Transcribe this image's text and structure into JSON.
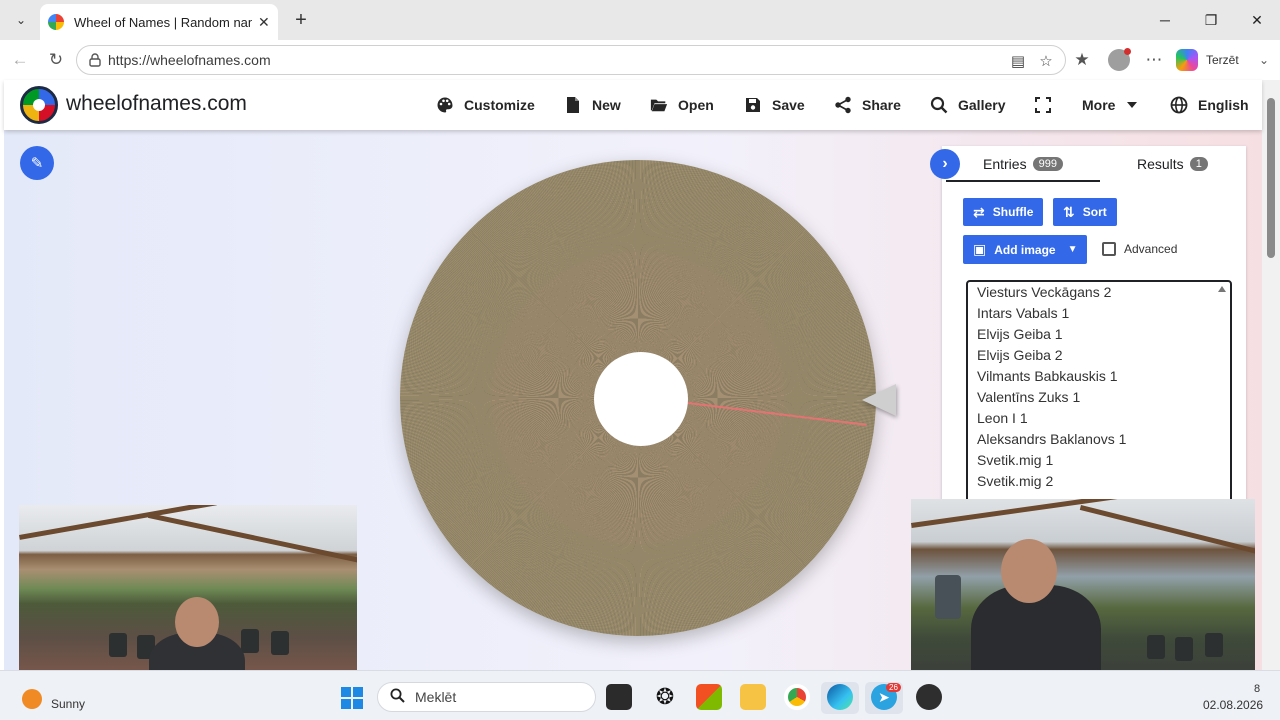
{
  "browser": {
    "tab_title": "Wheel of Names | Random name picker",
    "tab_close": "✕",
    "new_tab": "+",
    "url": "https://wheelofnames.com",
    "profile_button": "Terzēt",
    "window_controls": {
      "minimize": "─",
      "maximize": "❐",
      "close": "✕"
    }
  },
  "site": {
    "name": "wheelofnames.com",
    "nav": [
      {
        "label": "Customize",
        "icon": "palette-icon"
      },
      {
        "label": "New",
        "icon": "file-icon"
      },
      {
        "label": "Open",
        "icon": "folder-open-icon"
      },
      {
        "label": "Save",
        "icon": "floppy-disk-icon"
      },
      {
        "label": "Share",
        "icon": "share-icon"
      },
      {
        "label": "Gallery",
        "icon": "search-icon"
      },
      {
        "label": "",
        "icon": "fullscreen-icon"
      },
      {
        "label": "More",
        "icon": "caret-down-icon"
      },
      {
        "label": "English",
        "icon": "globe-icon"
      }
    ]
  },
  "panel": {
    "tabs": [
      {
        "label": "Entries",
        "badge": "999"
      },
      {
        "label": "Results",
        "badge": "1"
      }
    ],
    "buttons": {
      "shuffle": "Shuffle",
      "sort": "Sort",
      "add_image": "Add image"
    },
    "advanced_label": "Advanced",
    "entries": [
      "Viesturs Veckāgans 2",
      "Intars Vabals 1",
      "Elvijs Geiba 1",
      "Elvijs Geiba 2",
      "Vilmants Babkauskis 1",
      "Valentīns Zuks 1",
      "Leon I 1",
      "Aleksandrs Baklanovs 1",
      "Svetik.mig 1",
      "Svetik.mig 2"
    ]
  },
  "taskbar": {
    "weather": "Sunny",
    "search_placeholder": "Meklēt",
    "tray_number": "8",
    "date": "02.08.2026",
    "telegram_badge": "26"
  },
  "colors": {
    "accent": "#3369e8",
    "background_left": "#e4e9f9",
    "background_right": "#f6dfe2"
  }
}
